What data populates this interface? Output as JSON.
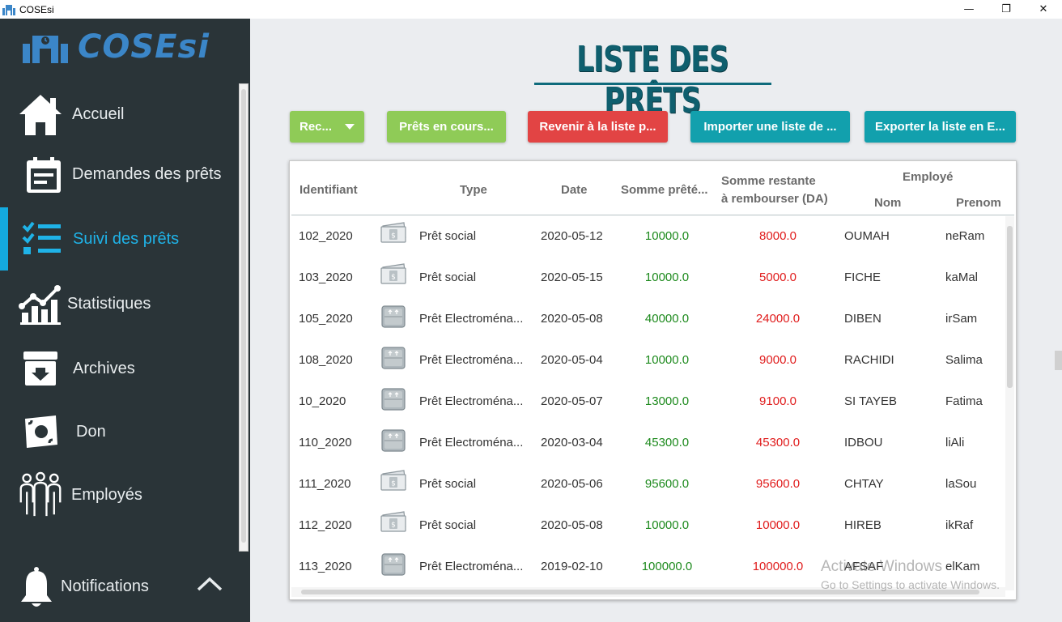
{
  "window": {
    "title": "COSEsi",
    "controls": {
      "minimize": "—",
      "maximize": "❐",
      "close": "✕"
    }
  },
  "sidebar": {
    "logo_text": "COSEsi",
    "items": [
      {
        "label": "Accueil",
        "icon": "home-icon"
      },
      {
        "label": "Demandes des prêts",
        "icon": "form-icon"
      },
      {
        "label": "Suivi des prêts",
        "icon": "checklist-icon",
        "active": true
      },
      {
        "label": "Statistiques",
        "icon": "stats-icon"
      },
      {
        "label": "Archives",
        "icon": "archive-icon"
      },
      {
        "label": "Don",
        "icon": "money-icon"
      },
      {
        "label": "Employés",
        "icon": "users-icon"
      }
    ],
    "notifications": {
      "label": "Notifications",
      "icon": "bell-icon",
      "toggle_icon": "chevron-up-icon"
    }
  },
  "main": {
    "title": "LISTE DES PRÊTS",
    "toolbar": {
      "filter_dropdown": "Rec...",
      "loans_in_progress": "Prêts en cours...",
      "back_to_list": "Revenir à la liste p...",
      "import_list": "Importer une liste de ...",
      "export_list": "Exporter la liste en E..."
    },
    "table": {
      "headers": {
        "identifiant": "Identifiant",
        "type": "Type",
        "date": "Date",
        "somme_pretee": "Somme prêté...",
        "somme_restante_line1": "Somme restante",
        "somme_restante_line2": "à rembourser (DA)",
        "employe": "Employé",
        "nom": "Nom",
        "prenom": "Prenom"
      },
      "rows": [
        {
          "id": "102_2020",
          "type": "Prêt social",
          "type_icon": "banknote-icon",
          "date": "2020-05-12",
          "lent": "10000.0",
          "remaining": "8000.0",
          "nom": "OUMAH",
          "prenom": "neRam"
        },
        {
          "id": "103_2020",
          "type": "Prêt social",
          "type_icon": "banknote-icon",
          "date": "2020-05-15",
          "lent": "10000.0",
          "remaining": "5000.0",
          "nom": "FICHE",
          "prenom": "kaMal"
        },
        {
          "id": "105_2020",
          "type": "Prêt Electroména...",
          "type_icon": "appliance-box-icon",
          "date": "2020-05-08",
          "lent": "40000.0",
          "remaining": "24000.0",
          "nom": "DIBEN",
          "prenom": "irSam"
        },
        {
          "id": "108_2020",
          "type": "Prêt Electroména...",
          "type_icon": "appliance-box-icon",
          "date": "2020-05-04",
          "lent": "10000.0",
          "remaining": "9000.0",
          "nom": "RACHIDI",
          "prenom": "Salima"
        },
        {
          "id": "10_2020",
          "type": "Prêt Electroména...",
          "type_icon": "appliance-box-icon",
          "date": "2020-05-07",
          "lent": "13000.0",
          "remaining": "9100.0",
          "nom": "SI TAYEB",
          "prenom": "Fatima"
        },
        {
          "id": "110_2020",
          "type": "Prêt Electroména...",
          "type_icon": "appliance-box-icon",
          "date": "2020-03-04",
          "lent": "45300.0",
          "remaining": "45300.0",
          "nom": "IDBOU",
          "prenom": "liAli"
        },
        {
          "id": "111_2020",
          "type": "Prêt social",
          "type_icon": "banknote-icon",
          "date": "2020-05-06",
          "lent": "95600.0",
          "remaining": "95600.0",
          "nom": "CHTAY",
          "prenom": "laSou"
        },
        {
          "id": "112_2020",
          "type": "Prêt social",
          "type_icon": "banknote-icon",
          "date": "2020-05-08",
          "lent": "10000.0",
          "remaining": "10000.0",
          "nom": "HIREB",
          "prenom": "ikRaf"
        },
        {
          "id": "113_2020",
          "type": "Prêt Electroména...",
          "type_icon": "appliance-box-icon",
          "date": "2019-02-10",
          "lent": "100000.0",
          "remaining": "100000.0",
          "nom": "AFSAF",
          "prenom": "elKam"
        }
      ]
    }
  },
  "watermark": {
    "line1": "Activate Windows",
    "line2": "Go to Settings to activate Windows."
  },
  "colors": {
    "sidebar_bg": "#2a3438",
    "accent_blue": "#14aadf",
    "btn_green": "#8fcb57",
    "btn_red": "#e24444",
    "btn_teal": "#12a0ad",
    "amount_green": "#1d8a1d",
    "amount_red": "#e01c1c"
  }
}
